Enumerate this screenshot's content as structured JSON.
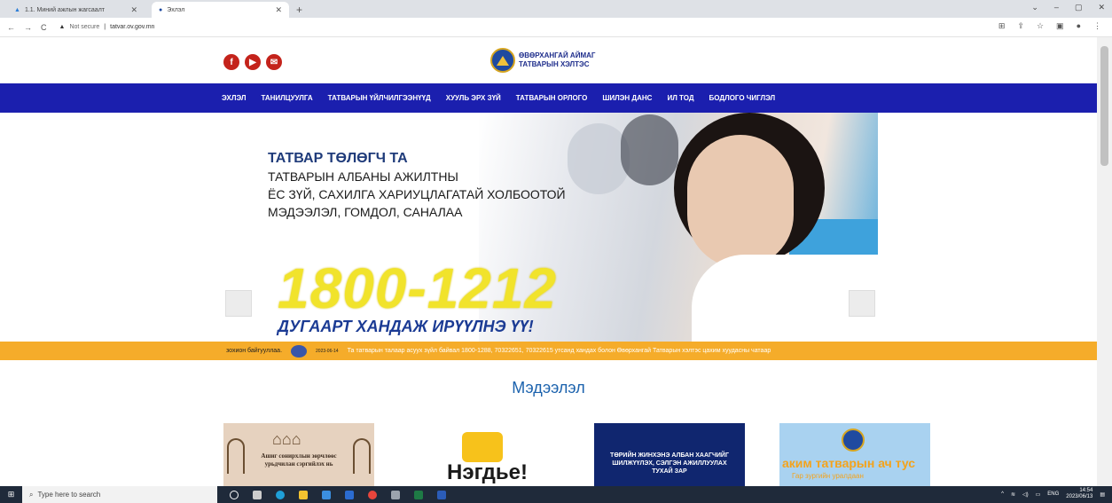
{
  "browser": {
    "tabs": [
      {
        "title": "1.1. Миний ажлын жагсаалт",
        "active": false
      },
      {
        "title": "Эхлэл",
        "active": true
      }
    ],
    "new_tab": "+",
    "security": "Not secure",
    "url": "tatvar.ov.gov.mn",
    "window_controls": [
      "⌄",
      "–",
      "▢",
      "✕"
    ]
  },
  "site": {
    "logo_line1": "ӨВӨРХАНГАЙ АЙМАГ",
    "logo_line2": "ТАТВАРЫН ХЭЛТЭС",
    "social_icons": [
      "facebook-icon",
      "youtube-icon",
      "email-icon"
    ],
    "nav": [
      "ЭХЛЭЛ",
      "ТАНИЛЦУУЛГА",
      "ТАТВАРЫН ҮЙЛЧИЛГЭЭНҮҮД",
      "ХУУЛЬ ЭРХ ЗҮЙ",
      "ТАТВАРЫН ОРЛОГО",
      "ШИЛЭН ДАНС",
      "ИЛ ТОД",
      "БОДЛОГО ЧИГЛЭЛ"
    ]
  },
  "hero": {
    "line1": "ТАТВАР ТӨЛӨГЧ ТА",
    "line2": "ТАТВАРЫН АЛБАНЫ АЖИЛТНЫ",
    "line3": "ЁС ЗҮЙ, САХИЛГА ХАРИУЦЛАГАТАЙ ХОЛБООТОЙ",
    "line4": "МЭДЭЭЛЭЛ, ГОМДОЛ, САНАЛАА",
    "phone": "1800-1212",
    "call_to_action": "ДУГААРТ ХАНДАЖ ИРҮҮЛНЭ ҮҮ!"
  },
  "ticker": {
    "prev_text": "зохион байгууллаа.",
    "date": "2023-06-14",
    "text": "Та татварын талаар асуух зүйл байвал 1800-1288, 70322651, 70322615 утсанд хандах болон Өвөрхангай Татварын хэлтэс цахим хуудасны чатаар"
  },
  "info": {
    "title": "Мэдээлэл",
    "cards": [
      {
        "text": "Ашиг сонирхлын зөрчлөөс урьдчилан сэргийлэх нь"
      },
      {
        "text": "Нэгдье!"
      },
      {
        "text": "ТӨРИЙН ЖИНХЭНЭ АЛБАН ХААГЧИЙГ ШИЛЖҮҮЛЭХ, СЭЛГЭН АЖИЛЛУУЛАХ ТУХАЙ ЗАР"
      },
      {
        "big": "аким татварын ач тус",
        "small": "Гар зургийн уралдаан"
      }
    ]
  },
  "taskbar": {
    "search_placeholder": "Type here to search",
    "lang": "ENG",
    "time": "14:54",
    "date": "2023/06/13"
  }
}
